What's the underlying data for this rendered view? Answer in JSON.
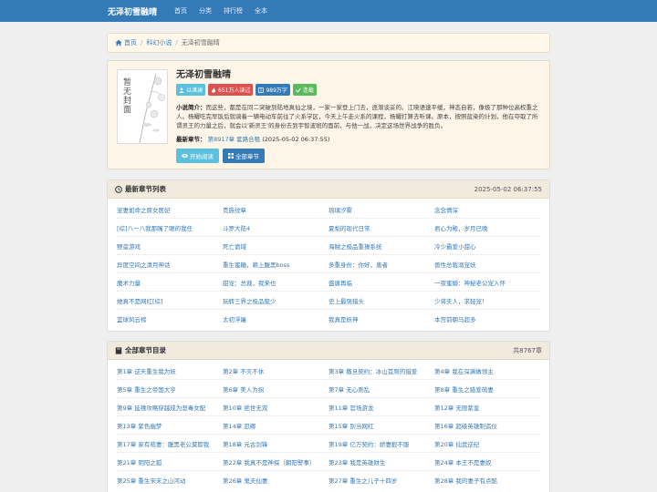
{
  "nav": {
    "brand": "无泽初雪融晴",
    "links": [
      "首页",
      "分类",
      "排行榜",
      "全本"
    ]
  },
  "breadcrumb": {
    "home": "首页",
    "category": "科幻小说",
    "current": "无泽初雪融晴"
  },
  "book": {
    "title": "无泽初雪融晴",
    "cover_text": "暂无封面",
    "tags": [
      {
        "icon": "user-icon",
        "text": "以渚澜"
      },
      {
        "icon": "fire-icon",
        "text": "651万人读过"
      },
      {
        "icon": "book-icon",
        "text": "989万字"
      },
      {
        "icon": "check-icon",
        "text": "连载"
      }
    ],
    "intro_label": "小说简介：",
    "intro": "而这些，都是在同二突破到陆地真仙之境，一家一家登上门去，逐渐谈妥的。江晓语速平缓，神态自若，像极了那种位高权重之人。杨耀吃完早饭后就骑着一辆电动车前往了火系学区，今天上午走火系的课程，杨耀打算去听课。原本，按照蓝染的计划，他在夺取了所谓灵王的力量之后，就会以'新灵王'的身份去到宇智波斑的面前，与他一战，决定这场世界战争的胜负。",
    "latest_label": "最新章节：",
    "latest_chapter": "第8917章 套路合租",
    "latest_time": "(2025-05-02 06:37:55)",
    "read_button": "开始阅读",
    "all_button": "全部章节"
  },
  "latest_panel": {
    "title": "最新章节列表",
    "time": "2025-05-02 06:37:55",
    "items": [
      "宠妻如命之原女医妃",
      "贵族纹章",
      "琉璃汐雾",
      "念念情深",
      "[综]八一八我那嘴了眼的我任",
      "斗罗大陆4",
      "夏梨的现代日常",
      "君心为殿，岁月已晚",
      "野蛮游戏",
      "死亡诡域",
      "海贼之极品重操系统",
      "冷少霸爱小甜心",
      "异度空间之清月神话",
      "重生蜜糖，赖上腹黑boss",
      "多重身份：你好，患者",
      "兽性总裁溺宠妖",
      "魔术力量",
      "甜宠：总裁，我来也",
      "盛唐再临",
      "一夜蜜婚：神秘老公宠入怀",
      "她真不是网红[综]",
      "玩转三界之极品废少",
      "史上最强猎头",
      "少将夫人，求轻宠！",
      "篮球风云榜",
      "太初浮屠",
      "我真是妖神",
      "本宫前朝马超多"
    ]
  },
  "all_panel": {
    "title": "全部章节目录",
    "count": "共8767章",
    "items": [
      "第1章 逆天重生我为妖",
      "第2章 不灭不休",
      "第3章 撒旦契约：冰山首席的猎爱",
      "第4章 我在深渊做领主",
      "第5章 重生之帝国大亨",
      "第6章 美人为拐",
      "第7章 无心则乱",
      "第8章 重生之猎爱萌妻",
      "第9章 延禧攻略穿越成为恶毒女配",
      "第10章 绝世无双",
      "第11章 官场游龙",
      "第12章 无限紫皇",
      "第13章 紫色幽梦",
      "第14章 忍卿",
      "第15章 别当网红",
      "第16章 超级英雄制造仪",
      "第17章 家有萌妻：腹黑老公莫欺我",
      "第18章 元古剑锋",
      "第19章 亿万契约：娇妻狠不服",
      "第20章 仙武逆纪",
      "第21章 阴阳之狐",
      "第22章 我真不是神探（朝阳警事）",
      "第23章 我是英雄财生",
      "第24章 本王不是妻奴",
      "第25章 重生宋末之山河动",
      "第26章 鬼夫仙妻",
      "第27章 重生之儿子十四岁",
      "第28章 我的妻子有点酷"
    ]
  },
  "colors": {
    "nav_bg": "#337ab7",
    "link": "#337ab7",
    "panel_head_bg": "#f1eadd",
    "book_bg": "#fdf5e8"
  }
}
